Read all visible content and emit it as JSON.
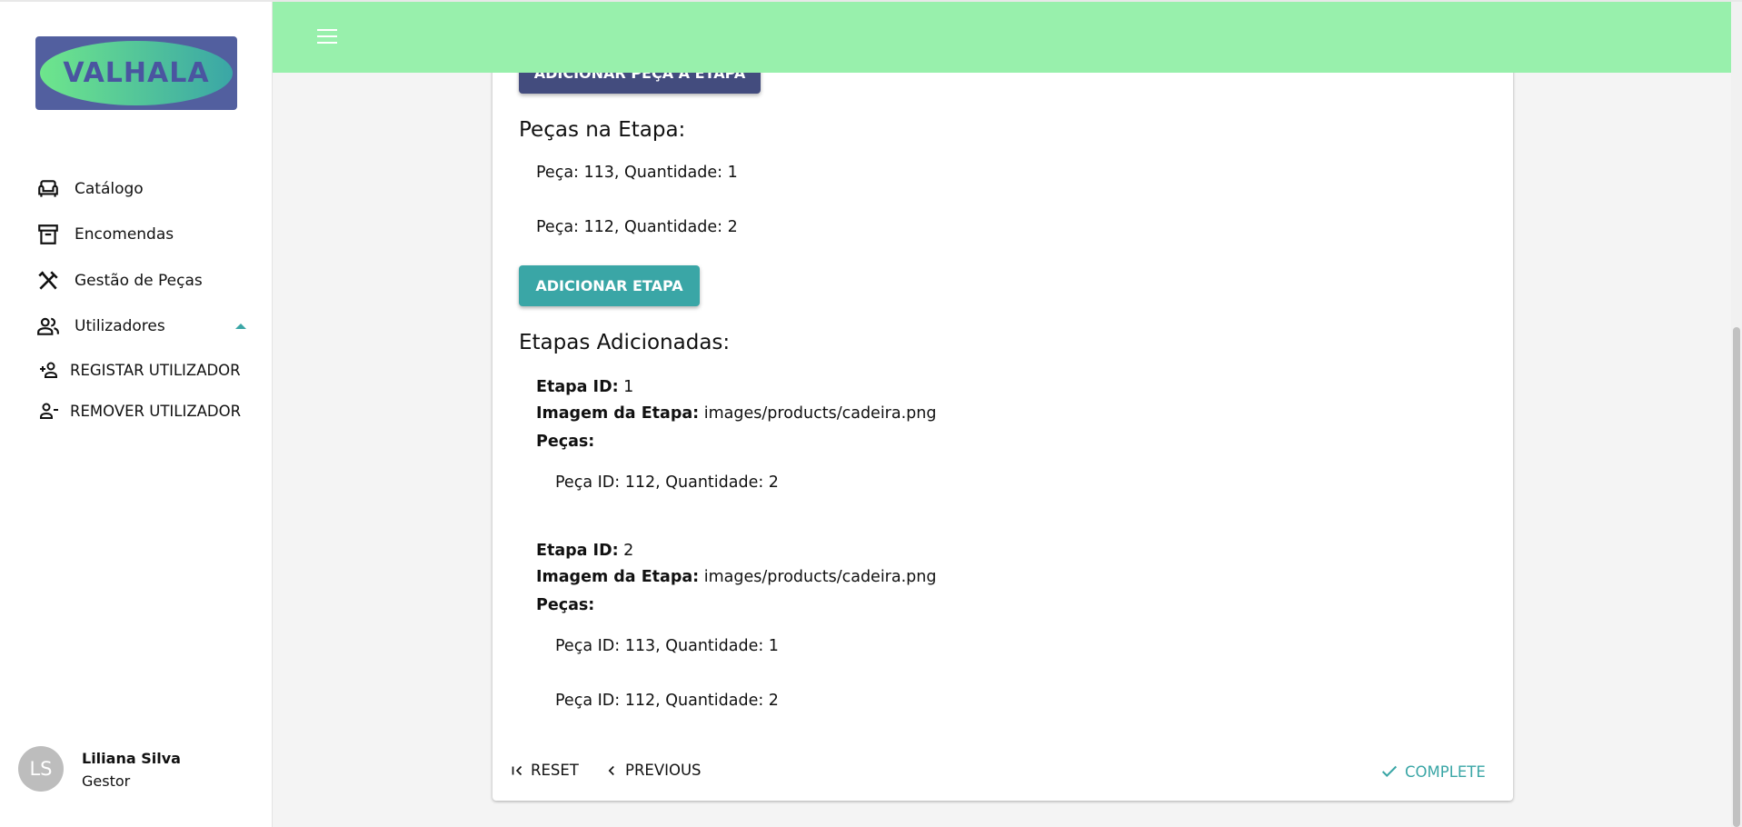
{
  "logo": {
    "text": "VALHALA"
  },
  "sidebar": {
    "items": [
      {
        "label": "Catálogo",
        "icon": "sofa-icon"
      },
      {
        "label": "Encomendas",
        "icon": "archive-icon"
      },
      {
        "label": "Gestão de Peças",
        "icon": "tools-icon"
      },
      {
        "label": "Utilizadores",
        "icon": "users-icon",
        "expanded": true
      }
    ],
    "subitems": [
      {
        "label": "REGISTAR UTILIZADOR",
        "icon": "person-add-icon"
      },
      {
        "label": "REMOVER UTILIZADOR",
        "icon": "person-remove-icon"
      }
    ]
  },
  "user": {
    "initials": "LS",
    "name": "Liliana Silva",
    "role": "Gestor"
  },
  "main": {
    "add_piece_button": "ADICIONAR PEÇA À ETAPA",
    "pieces_heading": "Peças na Etapa:",
    "pieces": [
      "Peça: 113, Quantidade: 1",
      "Peça: 112, Quantidade: 2"
    ],
    "add_step_button": "ADICIONAR ETAPA",
    "steps_heading": "Etapas Adicionadas:",
    "labels": {
      "id": "Etapa ID:",
      "image": "Imagem da Etapa:",
      "pieces": "Peças:"
    },
    "steps": [
      {
        "id": "1",
        "image": "images/products/cadeira.png",
        "pieces": [
          "Peça ID: 112, Quantidade: 2"
        ]
      },
      {
        "id": "2",
        "image": "images/products/cadeira.png",
        "pieces": [
          "Peça ID: 113, Quantidade: 1",
          "Peça ID: 112, Quantidade: 2"
        ]
      }
    ],
    "footer": {
      "reset": "RESET",
      "previous": "PREVIOUS",
      "complete": "COMPLETE"
    }
  },
  "colors": {
    "topbar": "#98f0ac",
    "primary_dark": "#434c7e",
    "teal": "#3aa6a6",
    "background": "#f4f4f4"
  }
}
